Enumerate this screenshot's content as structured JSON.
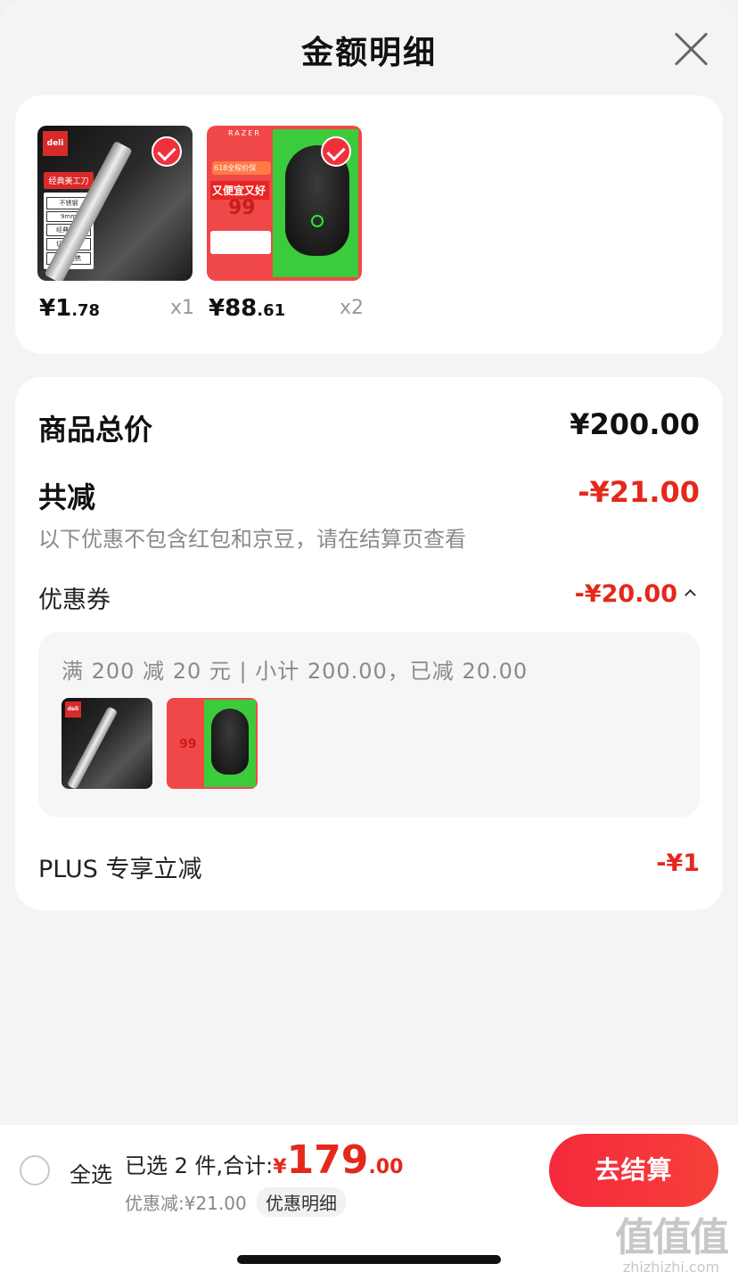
{
  "header": {
    "title": "金额明细"
  },
  "products": [
    {
      "brand_text": "deli",
      "image_tags": [
        "经典美工刀",
        "不锈钢",
        "9mm",
        "经典造型",
        "切割锋利",
        "小巧便携"
      ],
      "price_int": "¥1",
      "price_dec": ".78",
      "qty": "x1"
    },
    {
      "brand_text": "RAZER",
      "image_tags": [
        "618全程价保",
        "又便宜又好",
        "99"
      ],
      "price_int": "¥88",
      "price_dec": ".61",
      "qty": "x2"
    }
  ],
  "detail": {
    "total_label": "商品总价",
    "total_amount": "¥200.00",
    "reduce_label": "共减",
    "reduce_amount": "-¥21.00",
    "reduce_note": "以下优惠不包含红包和京豆，请在结算页查看",
    "coupon_label": "优惠券",
    "coupon_amount": "-¥20.00",
    "coupon_rule": "满 200 减 20 元 | 小计 200.00，已减 20.00",
    "plus_label": "PLUS 专享立减",
    "plus_amount": "-¥1"
  },
  "bottom_bar": {
    "select_all": "全选",
    "selected_text": "已选 2 件,合计:",
    "total_currency": "¥",
    "total_int": "179",
    "total_dec": ".00",
    "discount_text": "优惠减:¥21.00",
    "detail_link": "优惠明细",
    "checkout_label": "去结算"
  },
  "watermark": {
    "logo": "值值值",
    "url": "zhizhizhi.com"
  },
  "colors": {
    "accent_red": "#e4281c",
    "checkout_red": "#f5293c"
  }
}
